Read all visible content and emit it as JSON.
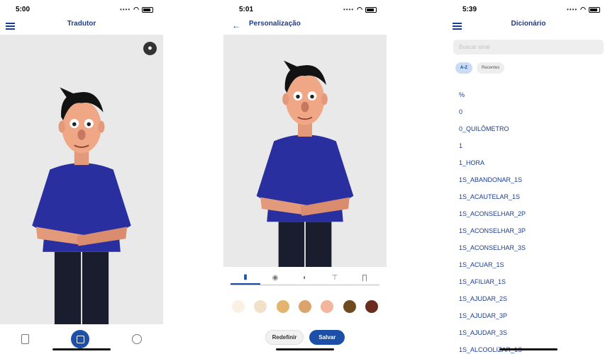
{
  "screen1": {
    "time": "5:00",
    "title": "Tradutor"
  },
  "screen2": {
    "time": "5:01",
    "title": "Personalização",
    "tabs": [
      "body-icon",
      "eye-icon",
      "hair-icon",
      "shirt-icon",
      "pants-icon"
    ],
    "swatches": [
      "#fbf0e3",
      "#f1e1c8",
      "#e2b46d",
      "#dca36c",
      "#f3b59e",
      "#6e4a1e",
      "#6a2c1e"
    ],
    "reset_label": "Redefinir",
    "save_label": "Salvar"
  },
  "screen3": {
    "time": "5:39",
    "title": "Dicionário",
    "search_placeholder": "Buscar sinal",
    "chips": [
      "A-Z",
      "Recentes"
    ],
    "items": [
      "%",
      "0",
      "0_QUILÔMETRO",
      "1",
      "1_HORA",
      "1S_ABANDONAR_1S",
      "1S_ACAUTELAR_1S",
      "1S_ACONSELHAR_2P",
      "1S_ACONSELHAR_3P",
      "1S_ACONSELHAR_3S",
      "1S_ACUAR_1S",
      "1S_AFILIAR_1S",
      "1S_AJUDAR_2S",
      "1S_AJUDAR_3P",
      "1S_AJUDAR_3S",
      "1S_ALCOOLIZAR_1S"
    ]
  }
}
